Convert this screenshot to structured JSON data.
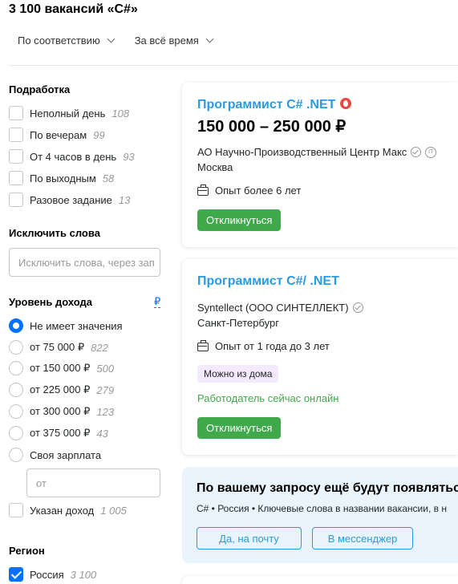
{
  "header": {
    "title": "3 100 вакансий «C#»",
    "sort_relevance": "По соответствию",
    "sort_period": "За всё время"
  },
  "filters": {
    "parttime": {
      "title": "Подработка",
      "items": [
        {
          "label": "Неполный день",
          "count": "108"
        },
        {
          "label": "По вечерам",
          "count": "99"
        },
        {
          "label": "От 4 часов в день",
          "count": "93"
        },
        {
          "label": "По выходным",
          "count": "58"
        },
        {
          "label": "Разовое задание",
          "count": "13"
        }
      ]
    },
    "exclude": {
      "title": "Исключить слова",
      "placeholder": "Исключить слова, через зап"
    },
    "income": {
      "title": "Уровень дохода",
      "currency_link": "₽",
      "options": [
        {
          "label": "Не имеет значения",
          "count": ""
        },
        {
          "label": "от 75 000 ₽",
          "count": "822"
        },
        {
          "label": "от 150 000 ₽",
          "count": "500"
        },
        {
          "label": "от 225 000 ₽",
          "count": "279"
        },
        {
          "label": "от 300 000 ₽",
          "count": "123"
        },
        {
          "label": "от 375 000 ₽",
          "count": "43"
        },
        {
          "label": "Своя зарплата",
          "count": ""
        }
      ],
      "own_placeholder": "от",
      "specified": {
        "label": "Указан доход",
        "count": "1 005"
      }
    },
    "region": {
      "title": "Регион",
      "items": [
        {
          "label": "Россия",
          "count": "3 100"
        }
      ]
    }
  },
  "vacancies": [
    {
      "title": "Программист C# .NET",
      "salary": "150 000 – 250 000 ₽",
      "company": "АО Научно-Производственный Центр Макс",
      "city": "Москва",
      "experience": "Опыт более 6 лет",
      "apply": "Откликнуться"
    },
    {
      "title": "Программист С#/ .NET",
      "company": "Syntellect (ООО СИНТЕЛЛЕКТ)",
      "city": "Санкт-Петербург",
      "experience": "Опыт от 1 года до 3 лет",
      "tag": "Можно из дома",
      "online": "Работодатель сейчас онлайн",
      "apply": "Откликнуться"
    }
  ],
  "promo": {
    "title": "По вашему запросу ещё будут появляться",
    "subtitle": "C# • Россия • Ключевые слова в названии вакансии, в н",
    "btn_mail": "Да, на почту",
    "btn_messenger": "В мессенджер"
  },
  "colors": {
    "accent": "#0070ff",
    "link": "#2a9be0",
    "green": "#3fa94b"
  }
}
